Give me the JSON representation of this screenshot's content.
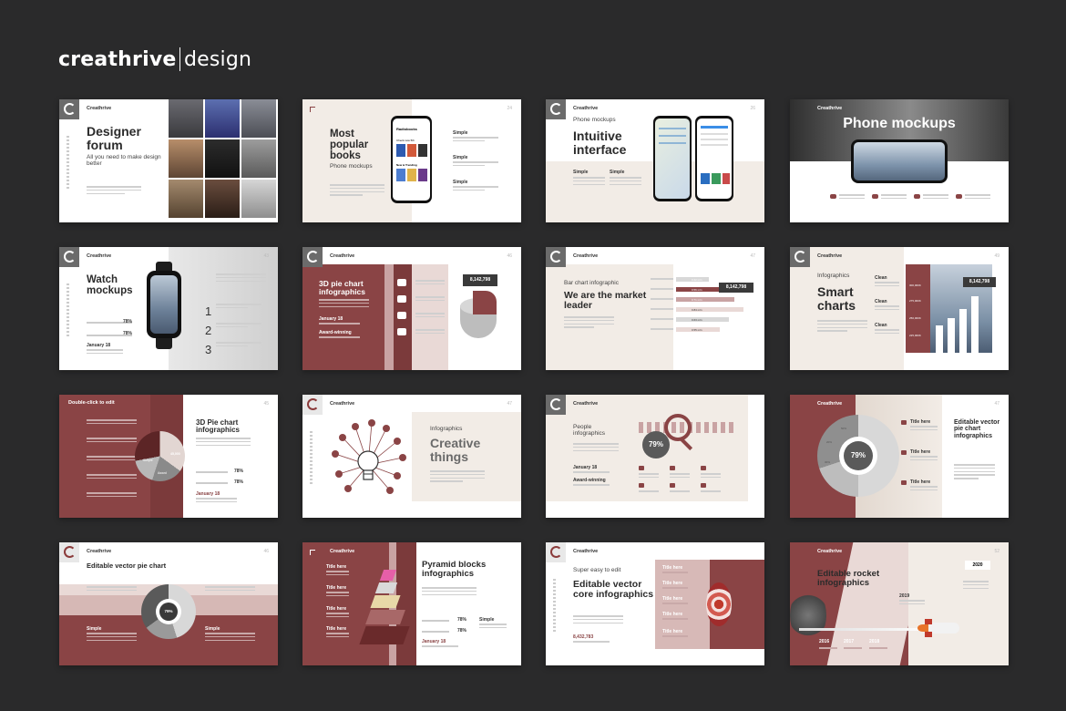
{
  "brand": {
    "bold": "creathrive",
    "light": "design"
  },
  "slides": {
    "s1": {
      "brand": "Creathrive",
      "title": "Designer forum",
      "sub": "All you need to make design better"
    },
    "s2": {
      "title": "Most popular books",
      "sub": "Phone mockups",
      "num": "24",
      "labels": [
        "Simple",
        "Simple",
        "Simple"
      ],
      "app_title": "Radiobooks",
      "app_sub": "Check new 5th",
      "app_sec": "New & Trending"
    },
    "s3": {
      "brand": "Creathrive",
      "kicker": "Phone mockups",
      "title": "Intuitive interface",
      "num": "26",
      "labels": [
        "Simple",
        "Simple"
      ]
    },
    "s4": {
      "brand": "Creathrive",
      "title": "Phone mockups"
    },
    "s5": {
      "brand": "Creathrive",
      "title": "Watch mockups",
      "num": "43",
      "pcts": [
        "78%",
        "78%"
      ],
      "date": "January 18",
      "steps": [
        "1",
        "2",
        "3"
      ]
    },
    "s6": {
      "brand": "Creathrive",
      "title": "3D pie chart infographics",
      "num": "46",
      "value": "8,142,798",
      "date": "January 18",
      "award": "Award-winning"
    },
    "s7": {
      "brand": "Creathrive",
      "kicker": "Bar chart infographic",
      "title": "We are the market leader",
      "num": "47",
      "value": "8,142,798",
      "bars": [
        "0.42 mln",
        "0.56 mln",
        "0.71 mln",
        "0.84 mln",
        "0.63 mln",
        "0.55 mln"
      ]
    },
    "s8": {
      "brand": "Creathrive",
      "kicker": "Infographics",
      "title": "Smart charts",
      "num": "49",
      "value": "8,142,798",
      "labels": [
        "Clean",
        "Clean",
        "Clean"
      ],
      "ticks": [
        "300,000K",
        "275,000K",
        "250,000K",
        "225,000K"
      ]
    },
    "s9": {
      "header": "Double-click to edit",
      "title": "3D Pie chart infographics",
      "num": "45",
      "pcts": [
        "78%",
        "78%"
      ],
      "date": "January 18",
      "pie_labels": [
        "45,000",
        "Award",
        "Simple"
      ]
    },
    "s10": {
      "brand": "Creathrive",
      "kicker": "Infographics",
      "title": "Creative things",
      "num": "47"
    },
    "s11": {
      "brand": "Creathrive",
      "kicker": "People infographics",
      "value": "79%",
      "date": "January 18",
      "award": "Award-winning"
    },
    "s12": {
      "brand": "Creathrive",
      "value": "79%",
      "title": "Editable vector pie chart infographics",
      "num": "47",
      "items": [
        "Title here",
        "Title here",
        "Title here"
      ],
      "pie_labels": [
        "50%",
        "20%",
        "30%"
      ]
    },
    "s13": {
      "brand": "Creathrive",
      "title": "Editable vector pie chart",
      "num": "46",
      "labels": [
        "Simple",
        "Simple"
      ],
      "center": "79%"
    },
    "s14": {
      "brand": "Creathrive",
      "title": "Pyramid blocks infographics",
      "items": [
        "Title here",
        "Title here",
        "Title here",
        "Title here"
      ],
      "pcts": [
        "78%",
        "78%"
      ],
      "side": "Simple",
      "date": "January 18"
    },
    "s15": {
      "brand": "Creathrive",
      "kicker": "Super easy to edit",
      "title": "Editable vector core infographics",
      "value": "8,432,783",
      "items": [
        "Title here",
        "Title here",
        "Title here",
        "Title here",
        "Title here"
      ]
    },
    "s16": {
      "brand": "Creathrive",
      "title": "Editable rocket infographics",
      "num": "52",
      "years": [
        "2020",
        "2019",
        "2018",
        "2017",
        "2016"
      ]
    }
  },
  "colors": {
    "maroon": "#8a4445",
    "beige": "#ede3da",
    "pink": "#c9a3a3",
    "bg": "#2a2a2b"
  }
}
